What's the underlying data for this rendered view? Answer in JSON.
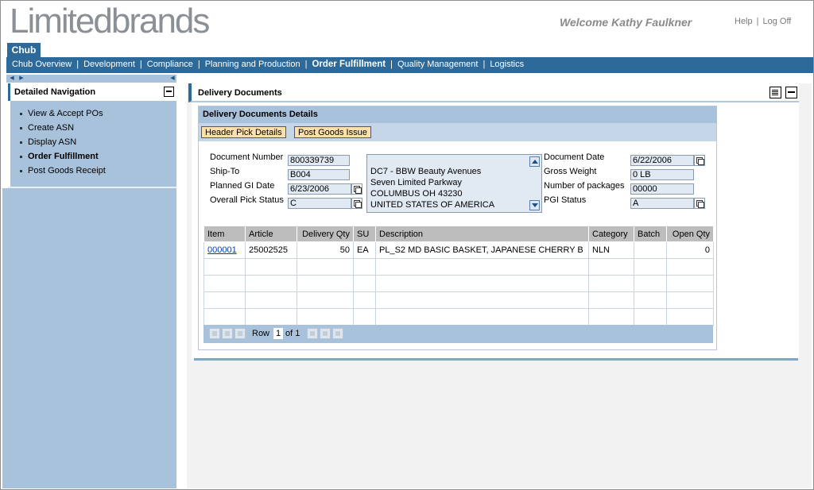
{
  "brand": {
    "logo_light": "Limited",
    "logo_bold": "brands"
  },
  "header": {
    "welcome": "Welcome Kathy Faulkner",
    "help": "Help",
    "sep": "|",
    "logoff": "Log Off"
  },
  "role_tab": "Chub",
  "nav": {
    "items": [
      "Chub Overview",
      "Development",
      "Compliance",
      "Planning and Production",
      "Order Fulfillment",
      "Quality Management",
      "Logistics"
    ],
    "active": "Order Fulfillment"
  },
  "left_nav": {
    "title": "Detailed Navigation",
    "items": [
      "View & Accept POs",
      "Create ASN",
      "Display ASN",
      "Order Fulfillment",
      "Post Goods Receipt"
    ],
    "active": "Order Fulfillment"
  },
  "content": {
    "title": "Delivery Documents",
    "group_title": "Delivery Documents Details",
    "buttons": {
      "header_pick": "Header Pick Details",
      "post_goods": "Post Goods Issue"
    }
  },
  "form": {
    "document_number": {
      "label": "Document Number",
      "value": "800339739"
    },
    "ship_to": {
      "label": "Ship-To",
      "value": "B004"
    },
    "planned_gi_date": {
      "label": "Planned GI Date",
      "value": "6/23/2006"
    },
    "overall_pick_status": {
      "label": "Overall Pick Status",
      "value": "C"
    },
    "address_lines": [
      "DC7 - BBW Beauty Avenues",
      "Seven Limited Parkway",
      "COLUMBUS OH  43230",
      "UNITED STATES OF AMERICA"
    ],
    "document_date": {
      "label": "Document Date",
      "value": "6/22/2006"
    },
    "gross_weight": {
      "label": "Gross Weight",
      "value": "0 LB"
    },
    "number_of_packages": {
      "label": "Number of packages",
      "value": "00000"
    },
    "pgi_status": {
      "label": "PGI Status",
      "value": "A"
    }
  },
  "table": {
    "columns": [
      "Item",
      "Article",
      "Delivery Qty",
      "SU",
      "Description",
      "Category",
      "Batch",
      "Open Qty"
    ],
    "rows": [
      {
        "item": "000001",
        "article": "25002525",
        "delivery_qty": "50",
        "su": "EA",
        "description": "PL_S2 MD BASIC BASKET, JAPANESE CHERRY B",
        "category": "NLN",
        "batch": "",
        "open_qty": "0"
      }
    ],
    "pager": {
      "row_label": "Row",
      "current": "1",
      "of_label": "of 1"
    }
  }
}
